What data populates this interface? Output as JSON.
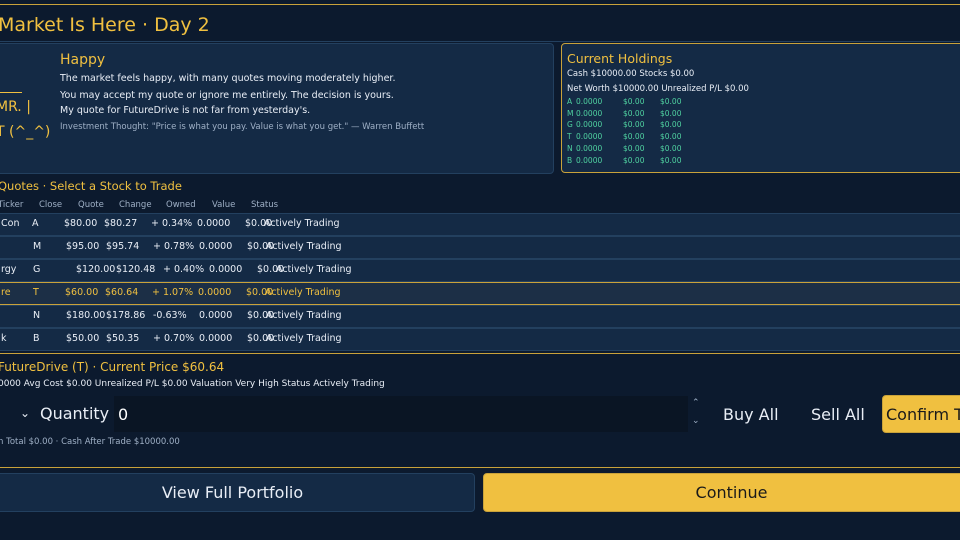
{
  "header": {
    "title": "Market Is Here · Day 2"
  },
  "mood": {
    "mascot_line1": "MR. |",
    "mascot_line2": "T (^_^)",
    "label": "Happy",
    "lines": [
      "The market feels happy, with many quotes moving moderately higher.",
      "You may accept my quote or ignore me entirely. The decision is yours.",
      "My quote for FutureDrive is not far from yesterday's."
    ],
    "quote": "Investment Thought: \"Price is what you pay. Value is what you get.\" — Warren Buffett"
  },
  "holdings": {
    "title": "Current Holdings",
    "cash_stocks": "Cash $10000.00  Stocks $0.00",
    "networth": "Net Worth $10000.00  Unrealized P/L $0.00",
    "rows": [
      {
        "ticker": "A",
        "shares": "0.0000",
        "value": "$0.00",
        "pl": "$0.00"
      },
      {
        "ticker": "M",
        "shares": "0.0000",
        "value": "$0.00",
        "pl": "$0.00"
      },
      {
        "ticker": "G",
        "shares": "0.0000",
        "value": "$0.00",
        "pl": "$0.00"
      },
      {
        "ticker": "T",
        "shares": "0.0000",
        "value": "$0.00",
        "pl": "$0.00"
      },
      {
        "ticker": "N",
        "shares": "0.0000",
        "value": "$0.00",
        "pl": "$0.00"
      },
      {
        "ticker": "B",
        "shares": "0.0000",
        "value": "$0.00",
        "pl": "$0.00"
      }
    ]
  },
  "quotes": {
    "title": "Quotes · Select a Stock to Trade",
    "headers": {
      "ticker": "Ticker",
      "close": "Close",
      "quote": "Quote",
      "change": "Change",
      "owned": "Owned",
      "value": "Value",
      "status": "Status"
    },
    "rows": [
      {
        "name": "Con",
        "ticker": "A",
        "close": "$80.00",
        "quote": "$80.27",
        "change": "+ 0.34%",
        "owned": "0.0000",
        "value": "$0.00",
        "status": "Actively Trading"
      },
      {
        "name": "",
        "ticker": "M",
        "close": "$95.00",
        "quote": "$95.74",
        "change": "+ 0.78%",
        "owned": "0.0000",
        "value": "$0.00",
        "status": "Actively Trading"
      },
      {
        "name": "rgy",
        "ticker": "G",
        "close": "$120.00",
        "quote": "$120.48",
        "change": "+ 0.40%",
        "owned": "0.0000",
        "value": "$0.00",
        "status": "Actively Trading"
      },
      {
        "name": "re",
        "ticker": "T",
        "close": "$60.00",
        "quote": "$60.64",
        "change": "+ 1.07%",
        "owned": "0.0000",
        "value": "$0.00",
        "status": "Actively Trading"
      },
      {
        "name": "",
        "ticker": "N",
        "close": "$180.00",
        "quote": "$178.86",
        "change": "-0.63%",
        "owned": "0.0000",
        "value": "$0.00",
        "status": "Actively Trading"
      },
      {
        "name": "k",
        "ticker": "B",
        "close": "$50.00",
        "quote": "$50.35",
        "change": "+ 0.70%",
        "owned": "0.0000",
        "value": "$0.00",
        "status": "Actively Trading"
      }
    ]
  },
  "selected": {
    "title": "FutureDrive (T) · Current Price $60.64",
    "info": "0000  Avg Cost $0.00  Unrealized P/L $0.00  Valuation Very High  Status Actively Trading"
  },
  "trade": {
    "quantity_label": "Quantity",
    "quantity_value": "0",
    "buy_all": "Buy All",
    "sell_all": "Sell All",
    "confirm": "Confirm Trade",
    "totals": "n Total $0.00 · Cash After Trade $10000.00"
  },
  "footer": {
    "portfolio": "View Full Portfolio",
    "continue": "Continue"
  },
  "colors": {
    "accent": "#f0c040",
    "background": "#0c1a2e",
    "panel": "#142a45",
    "gain": "#4fd1a0"
  }
}
